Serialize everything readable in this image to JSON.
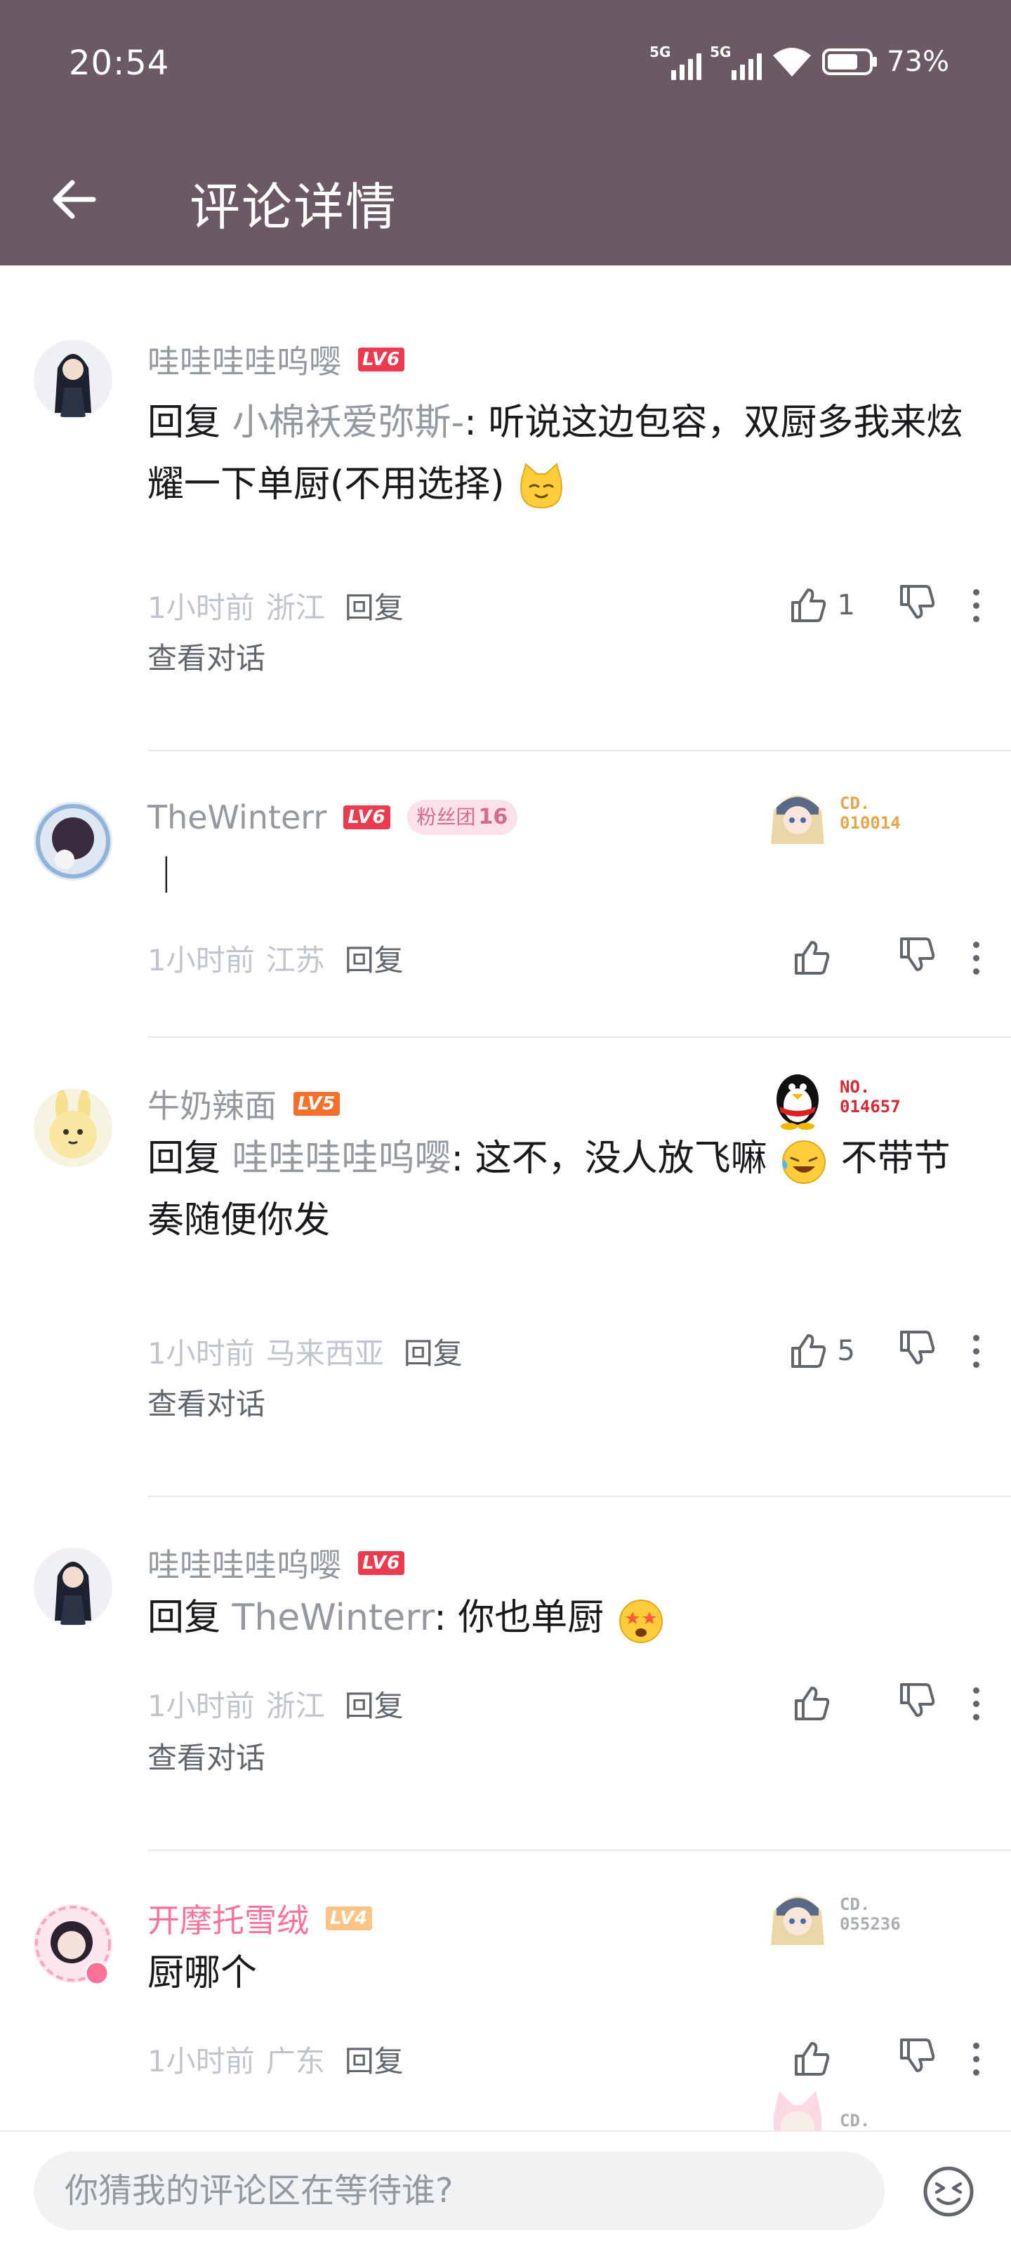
{
  "status_bar": {
    "time": "20:54",
    "net1": "5G",
    "net2": "5G",
    "battery": "73%"
  },
  "header": {
    "title": "评论详情"
  },
  "comments": [
    {
      "username": "哇哇哇哇呜嘤",
      "level": "LV6",
      "prefix": "回复 ",
      "mention": "小棉袄爱弥斯-",
      "text": ": 听说这边包容，双厨多我来炫耀一下单厨(不用选择)",
      "time": "1小时前",
      "location": "浙江",
      "reply": "回复",
      "likes": "1",
      "view": "查看对话"
    },
    {
      "username": "TheWinterr",
      "level": "LV6",
      "fan_label": "粉丝团",
      "fan_level": "16",
      "card_no": "CD.\n010014",
      "text": "|",
      "time": "1小时前",
      "location": "江苏",
      "reply": "回复",
      "likes": ""
    },
    {
      "username": "牛奶辣面",
      "level": "LV5",
      "card_no": "NO.\n014657",
      "prefix": "回复 ",
      "mention": "哇哇哇哇呜嘤",
      "text": ": 这不，没人放飞嘛",
      "text2": " 不带节奏随便你发",
      "time": "1小时前",
      "location": "马来西亚",
      "reply": "回复",
      "likes": "5",
      "view": "查看对话"
    },
    {
      "username": "哇哇哇哇呜嘤",
      "level": "LV6",
      "prefix": "回复 ",
      "mention": "TheWinterr",
      "text": ": 你也单厨",
      "time": "1小时前",
      "location": "浙江",
      "reply": "回复",
      "likes": "",
      "view": "查看对话"
    },
    {
      "username": "开摩托雪绒",
      "level": "LV4",
      "card_no": "CD.\n055236",
      "text": "厨哪个",
      "time": "1小时前",
      "location": "广东",
      "reply": "回复",
      "likes": ""
    }
  ],
  "partial_card": "CD.",
  "input": {
    "placeholder": "你猜我的评论区在等待谁?"
  },
  "colors": {
    "header_bg": "#6b5a63",
    "vip_pink": "#fb7299",
    "lv6": "#ea3c4e",
    "lv5": "#f3712a",
    "lv4": "#fdc485"
  }
}
